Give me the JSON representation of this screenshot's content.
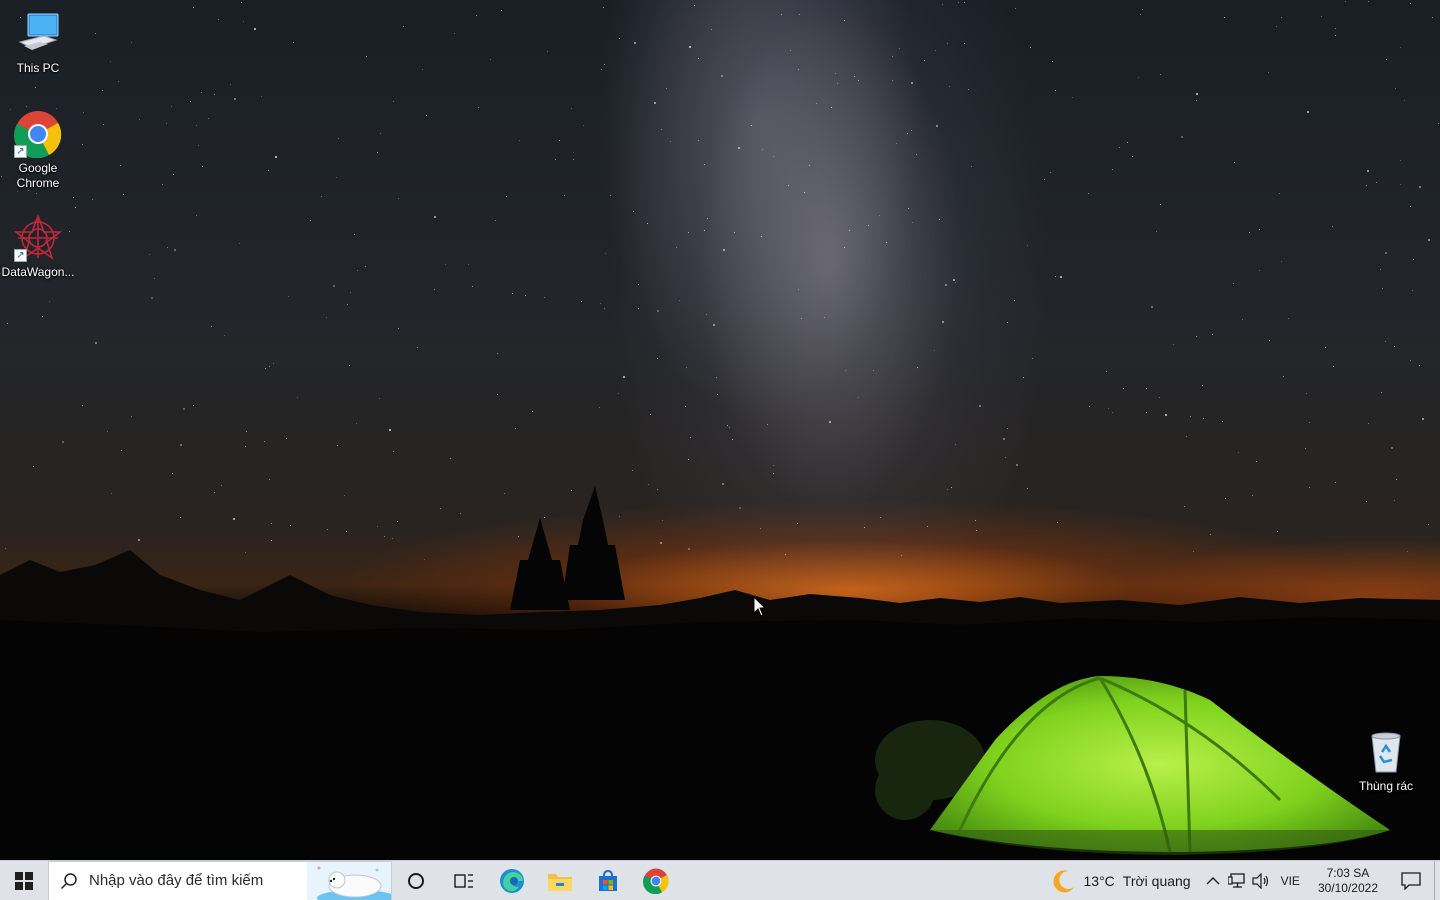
{
  "desktop": {
    "icons": [
      {
        "label": "This PC"
      },
      {
        "label": "Google\nChrome"
      },
      {
        "label": "DataWagon..."
      },
      {
        "label": "Thùng rác"
      }
    ]
  },
  "taskbar": {
    "search": {
      "placeholder": "Nhập vào đây để tìm kiếm"
    },
    "pinned": [
      "start-button",
      "cortana-button",
      "task-view-button",
      "edge",
      "file-explorer",
      "microsoft-store",
      "google-chrome"
    ],
    "weather": {
      "temperature": "13°C",
      "condition": "Trời quang",
      "icon": "moon-icon"
    },
    "language": "VIE",
    "clock": {
      "time": "7:03 SA",
      "date": "30/10/2022"
    }
  },
  "colors": {
    "taskbar_bg": "#dfe3e8",
    "tent_green": "#7fd21e",
    "horizon_orange": "#e66e14",
    "windows_blue": "#0078d7"
  }
}
